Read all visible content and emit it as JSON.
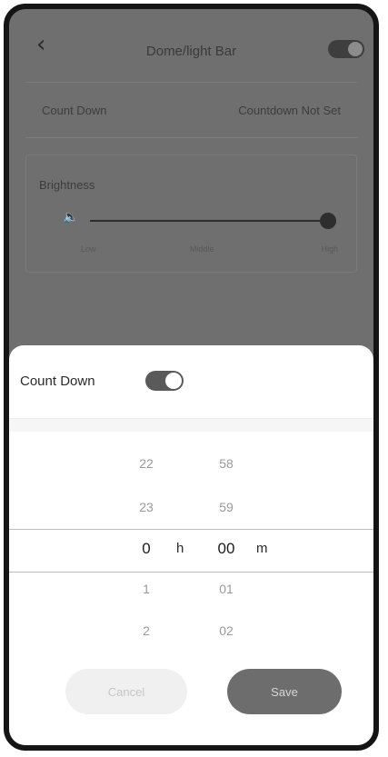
{
  "header": {
    "back_icon": "chevron-left-icon",
    "title": "Dome/light Bar"
  },
  "countdown_row": {
    "label": "Count Down",
    "value": "Countdown Not Set"
  },
  "brightness": {
    "label": "Brightness",
    "icon": "speaker-icon",
    "value": 1.0,
    "ticks": [
      "Low",
      "Middle",
      "High"
    ]
  },
  "sheet": {
    "countdown_label": "Count Down",
    "hours_prev": [
      "22",
      "23"
    ],
    "hours_selected": "0",
    "hours_next": [
      "1",
      "2"
    ],
    "hour_unit": "h",
    "minutes_prev": [
      "58",
      "59"
    ],
    "minutes_selected": "00",
    "minutes_next": [
      "01",
      "02"
    ],
    "minute_unit": "m",
    "cancel_label": "Cancel",
    "save_label": "Save"
  },
  "colors": {
    "overlay": "#6f6f6f",
    "accent": "#6d6d6d",
    "frame": "#151515"
  }
}
